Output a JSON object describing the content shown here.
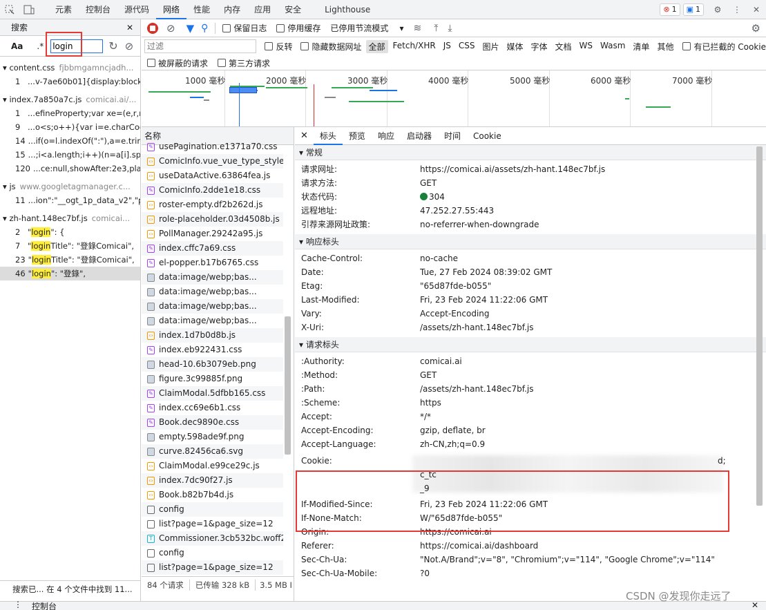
{
  "topbar": {
    "tabs": [
      "元素",
      "控制台",
      "源代码",
      "网络",
      "性能",
      "内存",
      "应用",
      "安全",
      "Lighthouse"
    ],
    "active_tab": "网络",
    "errors": "1",
    "messages": "1"
  },
  "search": {
    "title": "搜索",
    "aa": "Aa",
    "regex": ".*",
    "query": "login",
    "status": "搜索已...   在 4 个文件中找到 11...",
    "groups": [
      {
        "file": "content.css",
        "origin": "fjbbmgamncjadh...",
        "rows": [
          {
            "n": "1",
            "pre": "...v-7ae60b01]{display:block;...",
            "hl": "",
            "post": ""
          }
        ]
      },
      {
        "file": "index.7a850a7c.js",
        "origin": "comicai.ai/...",
        "rows": [
          {
            "n": "1",
            "pre": "...efineProperty;var xe=(e,r,n)...",
            "hl": "",
            "post": ""
          },
          {
            "n": "9",
            "pre": "...o<s;o++){var i=e.charCode...",
            "hl": "",
            "post": ""
          },
          {
            "n": "14",
            "pre": "...if(o=l.indexOf(\":\"),a=e.trim...",
            "hl": "",
            "post": ""
          },
          {
            "n": "15",
            "pre": "...;i<a.length;i++)(n=a[i].sp...",
            "hl": "",
            "post": ""
          },
          {
            "n": "120",
            "pre": "...ce:null,showAfter:2e3,pla...",
            "hl": "",
            "post": ""
          }
        ]
      },
      {
        "file": "js",
        "origin": "www.googletagmanager.c...",
        "rows": [
          {
            "n": "11",
            "pre": "...ion\":\"__ogt_1p_data_v2\",\"p...",
            "hl": "",
            "post": ""
          }
        ]
      },
      {
        "file": "zh-hant.148ec7bf.js",
        "origin": "comicai...",
        "rows": [
          {
            "n": "2",
            "pre": "\"",
            "hl": "login",
            "post": "\": {"
          },
          {
            "n": "7",
            "pre": "\"",
            "hl": "login",
            "post": "Title\": \"登錄Comicai\","
          },
          {
            "n": "23",
            "pre": "\"",
            "hl": "login",
            "post": "Title\": \"登錄Comicai\","
          },
          {
            "n": "46",
            "pre": "\"",
            "hl": "login",
            "post": "\": \"登錄\","
          }
        ]
      }
    ]
  },
  "toolbar": {
    "preserve_log": "保留日志",
    "disable_cache": "停用缓存",
    "throttle": "已停用节流模式"
  },
  "filter": {
    "placeholder": "过滤",
    "invert": "反转",
    "hide_data": "隐藏数据网址",
    "types": [
      "全部",
      "Fetch/XHR",
      "JS",
      "CSS",
      "图片",
      "媒体",
      "字体",
      "文档",
      "WS",
      "Wasm",
      "清单",
      "其他"
    ],
    "blocked_cookies": "有已拦截的 Cookie",
    "blocked_requests": "被屏蔽的请求",
    "third_party": "第三方请求"
  },
  "timeline": {
    "ticks": [
      "1000 毫秒",
      "2000 毫秒",
      "3000 毫秒",
      "4000 毫秒",
      "5000 毫秒",
      "6000 毫秒",
      "7000 毫秒"
    ]
  },
  "list": {
    "header": "名称",
    "items": [
      {
        "name": "usePagination.e1371a70.css",
        "t": "css"
      },
      {
        "name": "ComicInfo.vue_vue_type_style_i...",
        "t": "js"
      },
      {
        "name": "useDataActive.63864fea.js",
        "t": "js"
      },
      {
        "name": "ComicInfo.2dde1e18.css",
        "t": "css"
      },
      {
        "name": "roster-empty.df2b262d.js",
        "t": "js"
      },
      {
        "name": "role-placeholder.03d4508b.js",
        "t": "js"
      },
      {
        "name": "PollManager.29242a95.js",
        "t": "js"
      },
      {
        "name": "index.cffc7a69.css",
        "t": "css"
      },
      {
        "name": "el-popper.b17b6765.css",
        "t": "css"
      },
      {
        "name": "data:image/webp;bas...",
        "t": "img"
      },
      {
        "name": "data:image/webp;bas...",
        "t": "img"
      },
      {
        "name": "data:image/webp;bas...",
        "t": "img"
      },
      {
        "name": "data:image/webp;bas...",
        "t": "img"
      },
      {
        "name": "index.1d7b0d8b.js",
        "t": "js"
      },
      {
        "name": "index.eb922431.css",
        "t": "css"
      },
      {
        "name": "head-10.6b3079eb.png",
        "t": "img"
      },
      {
        "name": "figure.3c99885f.png",
        "t": "img"
      },
      {
        "name": "ClaimModal.5dfbb165.css",
        "t": "css"
      },
      {
        "name": "index.cc69e6b1.css",
        "t": "css"
      },
      {
        "name": "Book.dec9890e.css",
        "t": "css"
      },
      {
        "name": "empty.598ade9f.png",
        "t": "img"
      },
      {
        "name": "curve.82456ca6.svg",
        "t": "img"
      },
      {
        "name": "ClaimModal.e99ce29c.js",
        "t": "js"
      },
      {
        "name": "index.7dc90f27.js",
        "t": "js"
      },
      {
        "name": "Book.b82b7b4d.js",
        "t": "js"
      },
      {
        "name": "config",
        "t": "doc"
      },
      {
        "name": "list?page=1&page_size=12",
        "t": "doc"
      },
      {
        "name": "Commissioner.3cb532bc.woff2",
        "t": "font"
      },
      {
        "name": "config",
        "t": "doc"
      },
      {
        "name": "list?page=1&page_size=12",
        "t": "doc"
      }
    ],
    "footer": {
      "requests": "84 个请求",
      "transferred": "已传输 328 kB",
      "resources": "3.5 MB I"
    }
  },
  "details": {
    "tabs": [
      "标头",
      "预览",
      "响应",
      "启动器",
      "时间",
      "Cookie"
    ],
    "active_tab": "标头",
    "general_title": "常规",
    "general": [
      {
        "k": "请求网址:",
        "v": "https://comicai.ai/assets/zh-hant.148ec7bf.js"
      },
      {
        "k": "请求方法:",
        "v": "GET"
      },
      {
        "k": "状态代码:",
        "v": "304"
      },
      {
        "k": "远程地址:",
        "v": "47.252.27.55:443"
      },
      {
        "k": "引荐来源网址政策:",
        "v": "no-referrer-when-downgrade"
      }
    ],
    "resp_title": "响应标头",
    "resp": [
      {
        "k": "Cache-Control:",
        "v": "no-cache"
      },
      {
        "k": "Date:",
        "v": "Tue, 27 Feb 2024 08:39:02 GMT"
      },
      {
        "k": "Etag:",
        "v": "\"65d87fde-b055\""
      },
      {
        "k": "Last-Modified:",
        "v": "Fri, 23 Feb 2024 11:22:06 GMT"
      },
      {
        "k": "Vary:",
        "v": "Accept-Encoding"
      },
      {
        "k": "X-Uri:",
        "v": "/assets/zh-hant.148ec7bf.js"
      }
    ],
    "req_title": "请求标头",
    "req": [
      {
        "k": ":Authority:",
        "v": "comicai.ai"
      },
      {
        "k": ":Method:",
        "v": "GET"
      },
      {
        "k": ":Path:",
        "v": "/assets/zh-hant.148ec7bf.js"
      },
      {
        "k": ":Scheme:",
        "v": "https"
      },
      {
        "k": "Accept:",
        "v": "*/*"
      },
      {
        "k": "Accept-Encoding:",
        "v": "gzip, deflate, br"
      },
      {
        "k": "Accept-Language:",
        "v": "zh-CN,zh;q=0.9"
      }
    ],
    "cookie_key": "Cookie:",
    "cookie_parts": [
      "d;",
      "c_tc",
      "_9"
    ],
    "req2": [
      {
        "k": "If-Modified-Since:",
        "v": "Fri, 23 Feb 2024 11:22:06 GMT"
      },
      {
        "k": "If-None-Match:",
        "v": "W/\"65d87fde-b055\""
      },
      {
        "k": "Origin:",
        "v": "https://comicai.ai"
      },
      {
        "k": "Referer:",
        "v": "https://comicai.ai/dashboard"
      },
      {
        "k": "Sec-Ch-Ua:",
        "v": "\"Not.A/Brand\";v=\"8\", \"Chromium\";v=\"114\", \"Google Chrome\";v=\"114\""
      },
      {
        "k": "Sec-Ch-Ua-Mobile:",
        "v": "?0"
      }
    ]
  },
  "bottom": {
    "label": "控制台"
  },
  "watermark": "CSDN @发现你走远了"
}
